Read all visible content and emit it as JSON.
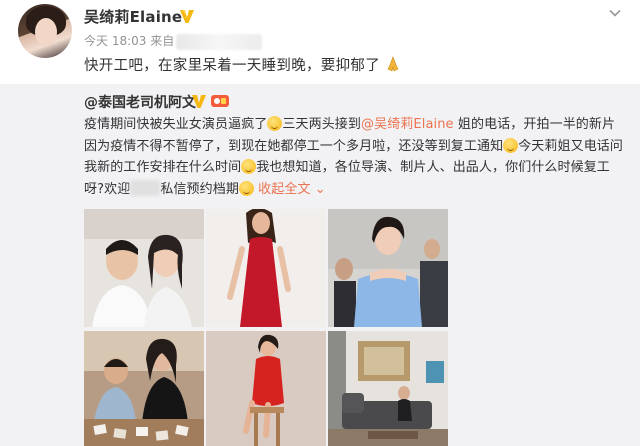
{
  "post": {
    "author": "吴绮莉Elaine",
    "time_prefix": "今天 18:03 来自",
    "text": "快开工吧，在家里呆着一天睡到晚，要抑郁了"
  },
  "repost": {
    "author": "@泰国老司机阿文",
    "segments": {
      "s1": "疫情期间快被失业女演员逼疯了",
      "s2": "三天两头接到",
      "mention": "@吴绮莉Elaine",
      "s3": " 姐的电话，开拍一半的新片因为疫情不得不暂停了，到现在她都停工一个多月啦，还没等到复工通知",
      "s4": "今天莉姐又电话问我新的工作安排在什么时间",
      "s5": "我也想知道，各位导演、制片人、出品人，你们什么时候复工呀?欢迎",
      "s6": "私信预约档期",
      "expand": "收起全文 ⌄"
    }
  },
  "images": [
    {
      "name": "couple-selfie-photo"
    },
    {
      "name": "red-dress-photo"
    },
    {
      "name": "blue-top-event-photo"
    },
    {
      "name": "family-table-photo"
    },
    {
      "name": "red-outfit-sitting-photo"
    },
    {
      "name": "living-room-photo"
    }
  ],
  "colors": {
    "accent": "#eb7350",
    "repost_bg": "#f2f2f5",
    "meta_gray": "#939393"
  },
  "icons": {
    "vip": "gold-v-badge-icon",
    "menu": "chevron-down-icon",
    "pray": "praying-hands-icon"
  }
}
